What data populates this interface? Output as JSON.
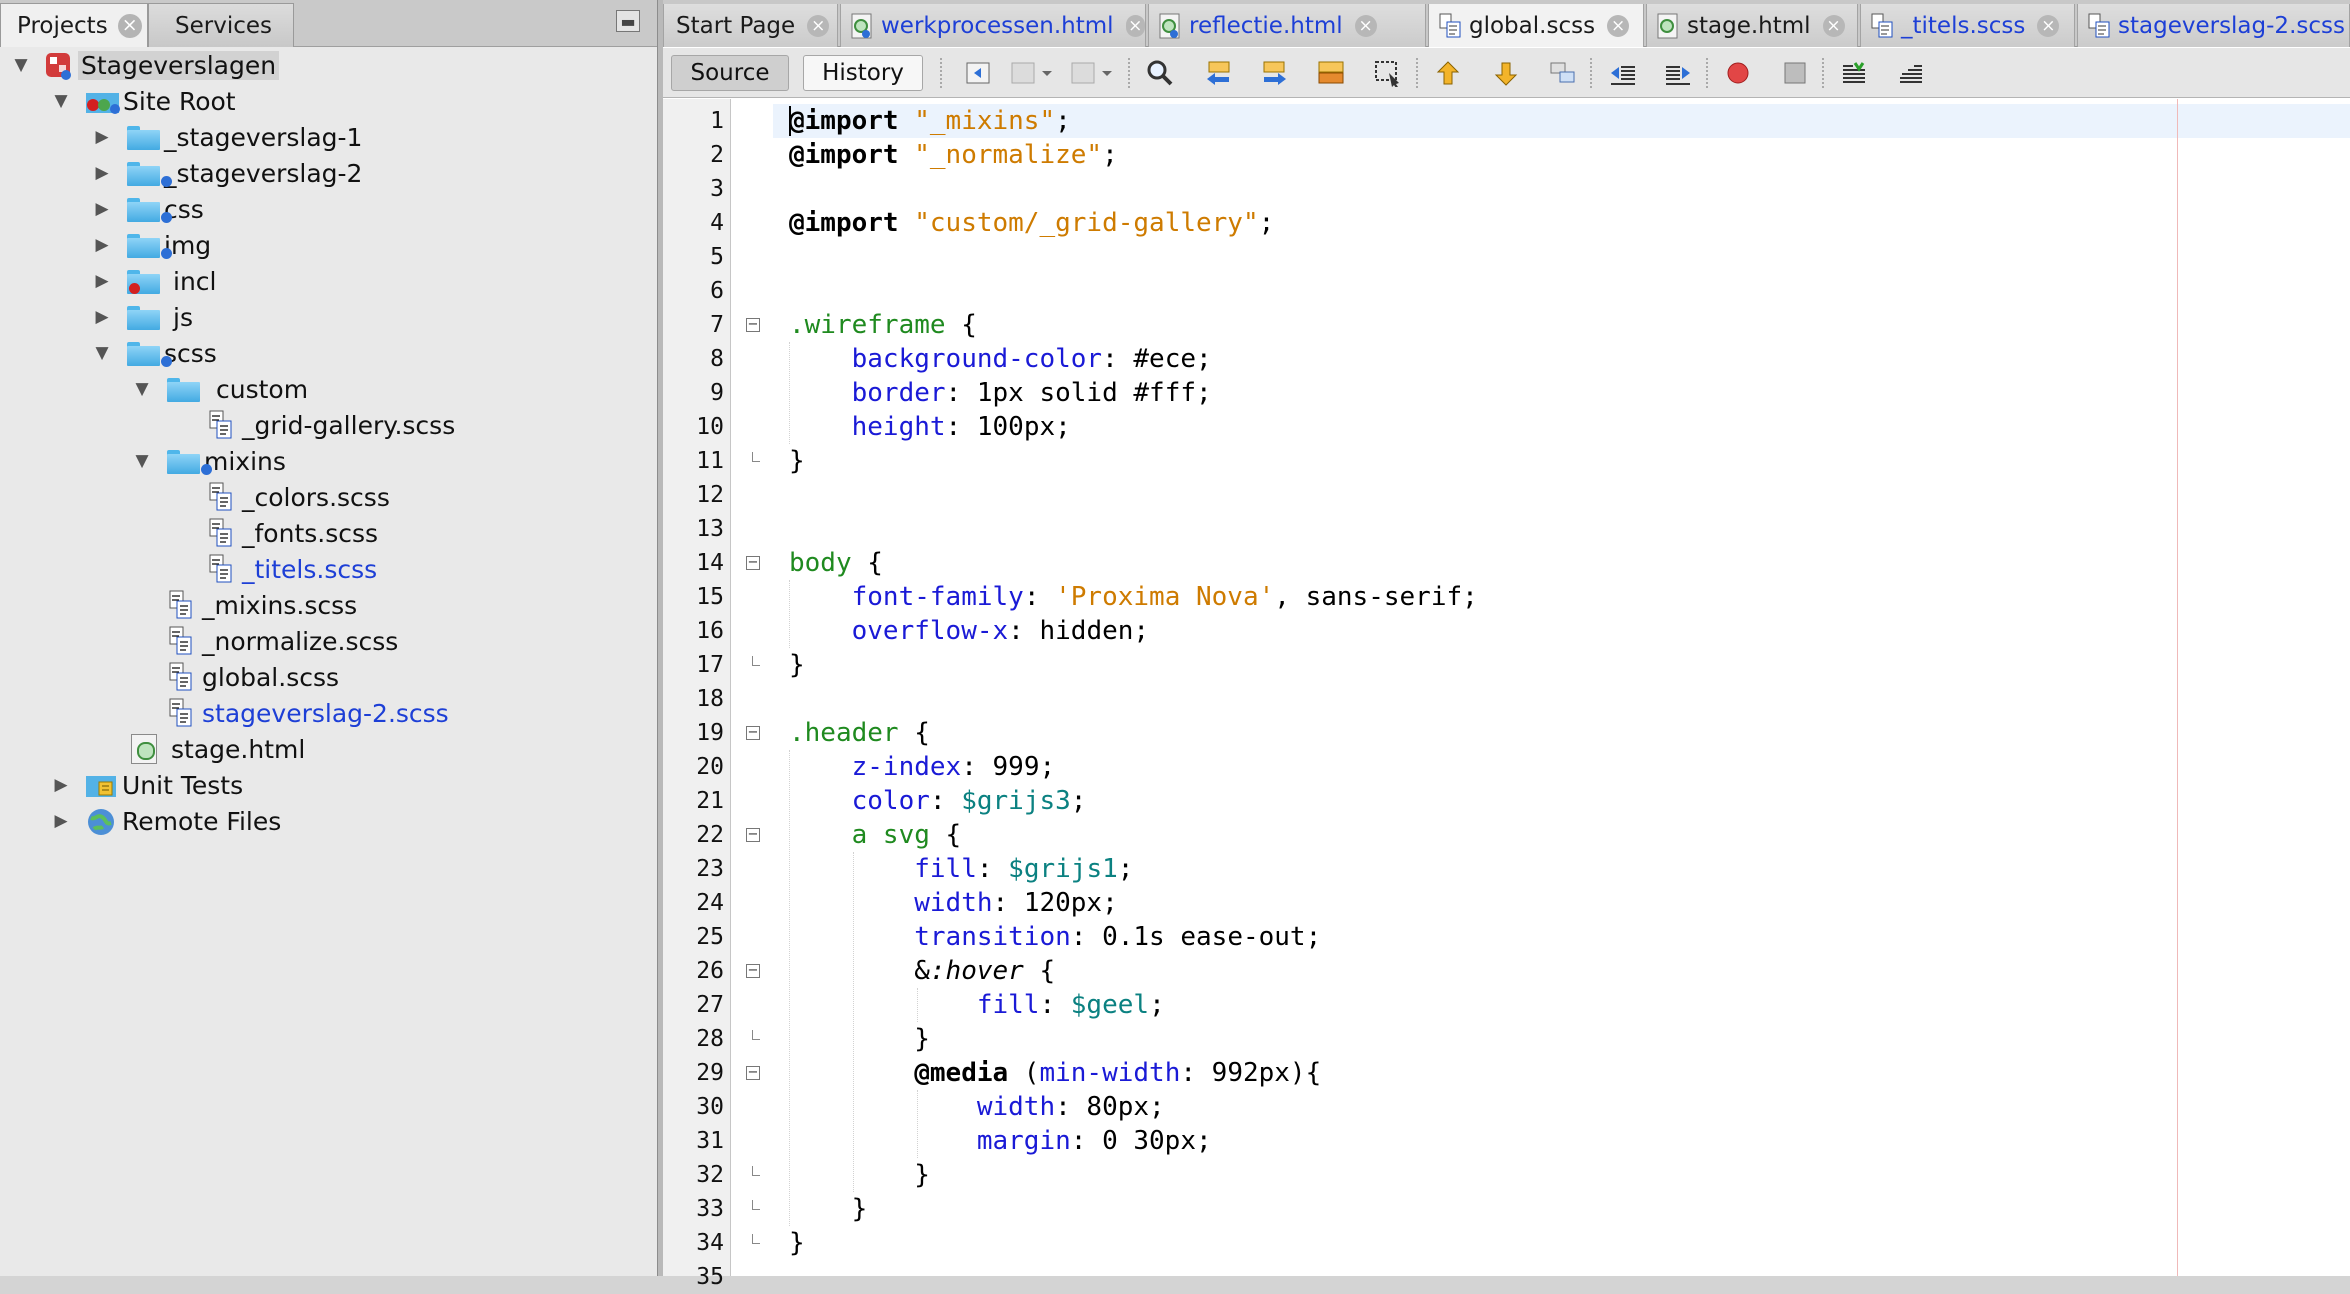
{
  "left_panel": {
    "tabs": [
      {
        "label": "Projects",
        "active": true
      },
      {
        "label": "Services",
        "active": false
      }
    ],
    "minimize_icon": "minimize-icon",
    "tree": [
      {
        "label": "Stageverslagen",
        "type": "project",
        "expanded": true
      },
      {
        "label": "Site Root",
        "type": "siteroot",
        "expanded": true
      },
      {
        "label": "_stageverslag-1",
        "type": "folder",
        "expanded": false
      },
      {
        "label": "_stageverslag-2",
        "type": "folder",
        "expanded": false,
        "badge": "blue"
      },
      {
        "label": "css",
        "type": "folder",
        "expanded": false,
        "badge": "blue"
      },
      {
        "label": "img",
        "type": "folder",
        "expanded": false,
        "badge": "blue"
      },
      {
        "label": "incl",
        "type": "folder",
        "expanded": false,
        "badge": "red"
      },
      {
        "label": "js",
        "type": "folder",
        "expanded": false
      },
      {
        "label": "scss",
        "type": "folder",
        "expanded": true,
        "badge": "blue"
      },
      {
        "label": "custom",
        "type": "folder",
        "expanded": true
      },
      {
        "label": "_grid-gallery.scss",
        "type": "scss"
      },
      {
        "label": "mixins",
        "type": "folder",
        "expanded": true,
        "badge": "blue"
      },
      {
        "label": "_colors.scss",
        "type": "scss"
      },
      {
        "label": "_fonts.scss",
        "type": "scss"
      },
      {
        "label": "_titels.scss",
        "type": "scss",
        "modified": true
      },
      {
        "label": "_mixins.scss",
        "type": "scss"
      },
      {
        "label": "_normalize.scss",
        "type": "scss"
      },
      {
        "label": "global.scss",
        "type": "scss"
      },
      {
        "label": "stageverslag-2.scss",
        "type": "scss",
        "modified": true
      },
      {
        "label": "stage.html",
        "type": "html"
      },
      {
        "label": "Unit Tests",
        "type": "unittests",
        "expanded": false
      },
      {
        "label": "Remote Files",
        "type": "remote",
        "expanded": false
      }
    ]
  },
  "editor": {
    "tabs": [
      {
        "label": "Start Page",
        "icon": "none",
        "modified": false,
        "active": false
      },
      {
        "label": "werkprocessen.html",
        "icon": "html-file-icon",
        "modified": true,
        "active": false
      },
      {
        "label": "reflectie.html",
        "icon": "html-file-icon",
        "modified": true,
        "active": false
      },
      {
        "label": "global.scss",
        "icon": "scss-file-icon",
        "modified": false,
        "active": true
      },
      {
        "label": "stage.html",
        "icon": "html-file-icon",
        "modified": false,
        "active": false
      },
      {
        "label": "_titels.scss",
        "icon": "scss-file-icon",
        "modified": true,
        "active": false
      },
      {
        "label": "stageverslag-2.scss",
        "icon": "scss-file-icon",
        "modified": true,
        "active": false
      }
    ],
    "toolbar": {
      "source_label": "Source",
      "history_label": "History",
      "icons": [
        "last-edit-icon",
        "back-icon",
        "forward-icon",
        "find-icon",
        "find-previous-icon",
        "find-next-icon",
        "toggle-highlight-icon",
        "find-selection-icon",
        "previous-bookmark-icon",
        "next-bookmark-icon",
        "toggle-bookmark-icon",
        "shift-left-icon",
        "shift-right-icon",
        "start-macro-icon",
        "stop-macro-icon",
        "comment-icon",
        "uncomment-icon"
      ]
    },
    "lines": [
      "@import \"_mixins\";",
      "@import \"_normalize\";",
      "",
      "@import \"custom/_grid-gallery\";",
      "",
      "",
      ".wireframe {",
      "    background-color: #ece;",
      "    border: 1px solid #fff;",
      "    height: 100px;",
      "}",
      "",
      "",
      "body {",
      "    font-family: 'Proxima Nova', sans-serif;",
      "    overflow-x: hidden;",
      "}",
      "",
      ".header {",
      "    z-index: 999;",
      "    color: $grijs3;",
      "    a svg {",
      "        fill: $grijs1;",
      "        width: 120px;",
      "        transition: 0.1s ease-out;",
      "        &:hover {",
      "            fill: $geel;",
      "        }",
      "        @media (min-width: 992px){",
      "            width: 80px;",
      "            margin: 0 30px;",
      "        }",
      "    }",
      "}",
      ""
    ],
    "line_numbers": [
      "1",
      "2",
      "3",
      "4",
      "5",
      "6",
      "7",
      "8",
      "9",
      "10",
      "11",
      "12",
      "13",
      "14",
      "15",
      "16",
      "17",
      "18",
      "19",
      "20",
      "21",
      "22",
      "23",
      "24",
      "25",
      "26",
      "27",
      "28",
      "29",
      "30",
      "31",
      "32",
      "33",
      "34",
      "35"
    ],
    "colors": {
      "keyword": "#000000",
      "string": "#ce7b00",
      "selector": "#1f8a1f",
      "property": "#1a1ad6",
      "variable": "#0b8181",
      "modified_tab": "#1d3fd6"
    }
  }
}
